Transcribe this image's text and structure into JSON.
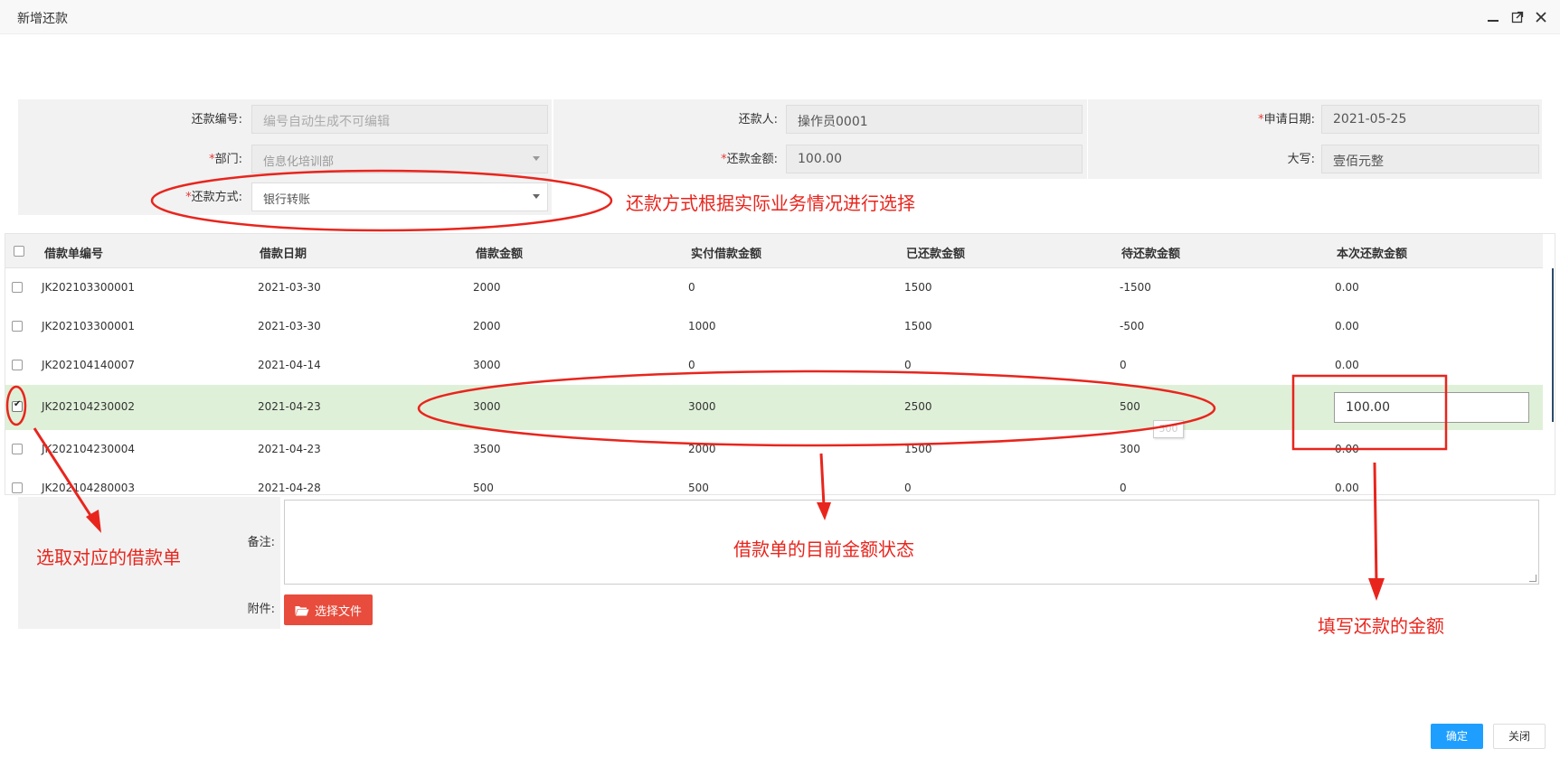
{
  "dialog": {
    "title": "新增还款",
    "minimize_icon": "minimize-icon",
    "maximize_icon": "maximize-icon",
    "close_icon": "close-icon"
  },
  "form": {
    "repay_no": {
      "label": "还款编号:",
      "placeholder": "编号自动生成不可编辑",
      "value": ""
    },
    "repayer": {
      "label": "还款人:",
      "value": "操作员0001"
    },
    "apply_date": {
      "label": "申请日期:",
      "value": "2021-05-25"
    },
    "department": {
      "label": "部门:",
      "value": "信息化培训部"
    },
    "repay_amount": {
      "label": "还款金额:",
      "value": "100.00"
    },
    "uppercase": {
      "label": "大写:",
      "value": "壹佰元整"
    },
    "repay_method": {
      "label": "还款方式:",
      "value": "银行转账"
    },
    "required_mark": "*"
  },
  "table": {
    "columns": [
      "借款单编号",
      "借款日期",
      "借款金额",
      "实付借款金额",
      "已还款金额",
      "待还款金额",
      "本次还款金额"
    ],
    "rows": [
      {
        "no": "JK202103300001",
        "date": "2021-03-30",
        "amount": "2000",
        "paid": "0",
        "repaid": "1500",
        "pending": "-1500",
        "this_repay": "0.00",
        "checked": false
      },
      {
        "no": "JK202103300001",
        "date": "2021-03-30",
        "amount": "2000",
        "paid": "1000",
        "repaid": "1500",
        "pending": "-500",
        "this_repay": "0.00",
        "checked": false
      },
      {
        "no": "JK202104140007",
        "date": "2021-04-14",
        "amount": "3000",
        "paid": "0",
        "repaid": "0",
        "pending": "0",
        "this_repay": "0.00",
        "checked": false
      },
      {
        "no": "JK202104230002",
        "date": "2021-04-23",
        "amount": "3000",
        "paid": "3000",
        "repaid": "2500",
        "pending": "500",
        "this_repay": "100.00",
        "checked": true
      },
      {
        "no": "JK202104230004",
        "date": "2021-04-23",
        "amount": "3500",
        "paid": "2000",
        "repaid": "1500",
        "pending": "300",
        "this_repay": "0.00",
        "checked": false
      },
      {
        "no": "JK202104280003",
        "date": "2021-04-28",
        "amount": "500",
        "paid": "500",
        "repaid": "0",
        "pending": "0",
        "this_repay": "0.00",
        "checked": false
      }
    ],
    "tooltip": "500"
  },
  "remarks": {
    "label": "备注:"
  },
  "attachment": {
    "label": "附件:",
    "button": "选择文件",
    "icon": "folder-open-icon"
  },
  "footer": {
    "confirm": "确定",
    "close": "关闭"
  },
  "annotations": {
    "method_note": "还款方式根据实际业务情况进行选择",
    "select_note": "选取对应的借款单",
    "status_note": "借款单的目前金额状态",
    "fill_note": "填写还款的金额",
    "color": "#e8251d"
  }
}
